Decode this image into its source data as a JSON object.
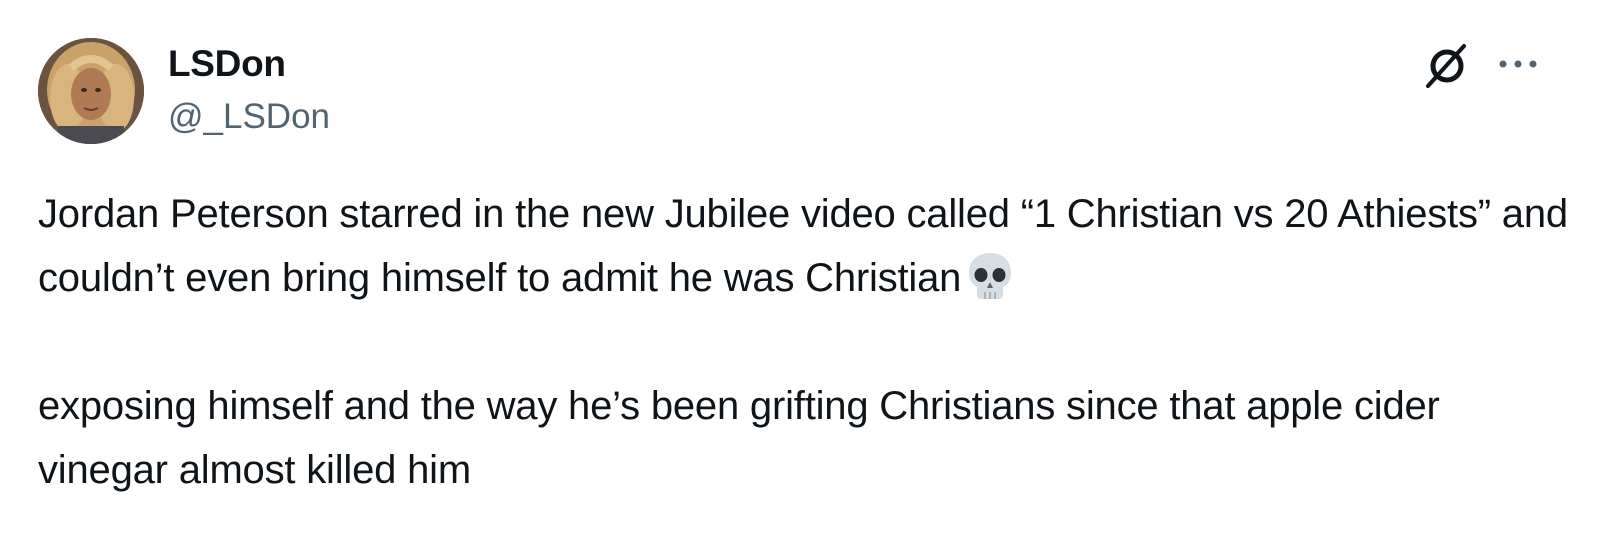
{
  "author": {
    "display_name": "LSDon",
    "handle": "@_LSDon",
    "avatar_icon": "avatar-photo"
  },
  "header_icons": {
    "grok": "grok-icon",
    "more": "more-options-icon"
  },
  "tweet": {
    "paragraph_1": "Jordan Peterson starred in the new Jubilee video called “1 Christian vs 20 Athiests” and couldn’t even bring himself to admit he was Christian",
    "paragraph_1_emoji": "skull-emoji",
    "paragraph_2": "exposing himself and the way he’s been grifting Christians since that apple cider vinegar almost killed him"
  },
  "colors": {
    "text_primary": "#0f1419",
    "text_secondary": "#536471",
    "background": "#ffffff"
  }
}
